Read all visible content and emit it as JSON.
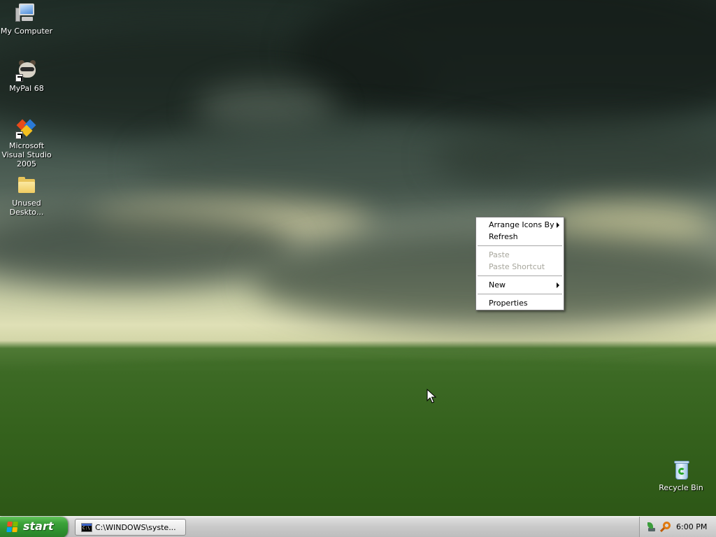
{
  "desktop": {
    "icons": [
      {
        "label": "My Computer",
        "icon": "computer-icon"
      },
      {
        "label": "MyPal 68",
        "icon": "raccoon-icon"
      },
      {
        "label": "Microsoft Visual Studio 2005",
        "icon": "visual-studio-icon"
      },
      {
        "label": "Unused Deskto...",
        "icon": "folder-icon"
      },
      {
        "label": "Recycle Bin",
        "icon": "recycle-bin-icon"
      }
    ]
  },
  "context_menu": {
    "items": [
      {
        "label": "Arrange Icons By",
        "submenu": true,
        "enabled": true
      },
      {
        "label": "Refresh",
        "submenu": false,
        "enabled": true
      },
      {
        "label": "Paste",
        "submenu": false,
        "enabled": false
      },
      {
        "label": "Paste Shortcut",
        "submenu": false,
        "enabled": false
      },
      {
        "label": "New",
        "submenu": true,
        "enabled": true
      },
      {
        "label": "Properties",
        "submenu": false,
        "enabled": true
      }
    ]
  },
  "taskbar": {
    "start_label": "start",
    "tasks": [
      {
        "label": "C:\\WINDOWS\\syste...",
        "icon": "command-prompt-icon"
      }
    ],
    "tray": {
      "icons": [
        "network-plant-icon",
        "search-tray-icon"
      ],
      "clock": "6:00 PM"
    }
  },
  "colors": {
    "start_green": "#3ca23a",
    "taskbar_gray": "#c9c9c9",
    "menu_disabled": "#a7a69c"
  }
}
